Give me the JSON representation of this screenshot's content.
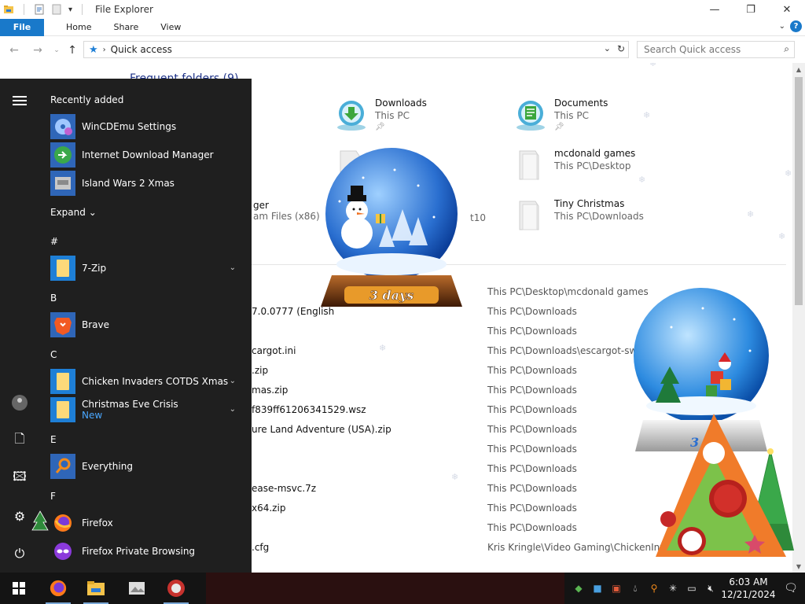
{
  "explorer": {
    "title": "File Explorer",
    "ribbon": {
      "file": "File",
      "tabs": [
        "Home",
        "Share",
        "View"
      ],
      "help": "?"
    },
    "address": {
      "crumb": "Quick access"
    },
    "search": {
      "placeholder": "Search Quick access"
    },
    "frequent_header": "Frequent folders (9)",
    "frequent": [
      {
        "name": "Downloads",
        "sub": "This PC",
        "pinned": true
      },
      {
        "name": "Documents",
        "sub": "This PC",
        "pinned": true
      },
      {
        "name": "mcdonald games",
        "sub": "This PC\\Desktop"
      },
      {
        "name": "ger",
        "sub": "am Files (x86)"
      },
      {
        "name": "Tiny Christmas",
        "sub": "This PC\\Downloads"
      },
      {
        "name": "t10",
        "sub": ""
      }
    ],
    "recent": [
      {
        "file": "",
        "location": "This PC\\Desktop\\mcdonald games"
      },
      {
        "file": "7.0.0777 (English",
        "location": "This PC\\Downloads"
      },
      {
        "file": "",
        "location": "This PC\\Downloads"
      },
      {
        "file": "cargot.ini",
        "location": "This PC\\Downloads\\escargot-sw"
      },
      {
        "file": ".zip",
        "location": "This PC\\Downloads"
      },
      {
        "file": "mas.zip",
        "location": "This PC\\Downloads"
      },
      {
        "file": "f839ff61206341529.wsz",
        "location": "This PC\\Downloads"
      },
      {
        "file": "ure Land Adventure (USA).zip",
        "location": "This PC\\Downloads"
      },
      {
        "file": "",
        "location": "This PC\\Downloads"
      },
      {
        "file": "",
        "location": "This PC\\Downloads"
      },
      {
        "file": "ease-msvc.7z",
        "location": "This PC\\Downloads"
      },
      {
        "file": "x64.zip",
        "location": "This PC\\Downloads"
      },
      {
        "file": "",
        "location": "This PC\\Downloads"
      },
      {
        "file": ".cfg",
        "location": "Kris Kringle\\Video Gaming\\ChickenInvade"
      }
    ]
  },
  "start": {
    "recently_added_label": "Recently added",
    "recent_apps": [
      "WinCDEmu Settings",
      "Internet Download Manager",
      "Island Wars 2 Xmas"
    ],
    "expand_label": "Expand",
    "groups": [
      {
        "letter": "#",
        "apps": [
          {
            "name": "7-Zip",
            "icon": "folder-icon",
            "chevron": true
          }
        ]
      },
      {
        "letter": "B",
        "apps": [
          {
            "name": "Brave",
            "icon": "brave-icon"
          }
        ]
      },
      {
        "letter": "C",
        "apps": [
          {
            "name": "Chicken Invaders COTDS Xmas",
            "icon": "folder-icon",
            "chevron": true
          },
          {
            "name": "Christmas Eve Crisis",
            "icon": "folder-icon",
            "chevron": true,
            "tag": "New"
          }
        ]
      },
      {
        "letter": "E",
        "apps": [
          {
            "name": "Everything",
            "icon": "magnifier-icon"
          }
        ]
      },
      {
        "letter": "F",
        "apps": [
          {
            "name": "Firefox",
            "icon": "firefox-icon"
          },
          {
            "name": "Firefox Private Browsing",
            "icon": "firefox-private-icon"
          }
        ]
      }
    ]
  },
  "globe_big": {
    "label": "3 days"
  },
  "globe_small": {
    "label": "3 d"
  },
  "taskbar": {
    "time": "6:03 AM",
    "date": "12/21/2024"
  },
  "colors": {
    "accent": "#1979ca",
    "start_bg": "#1f1f1f",
    "taskbar_bg": "#141414"
  }
}
